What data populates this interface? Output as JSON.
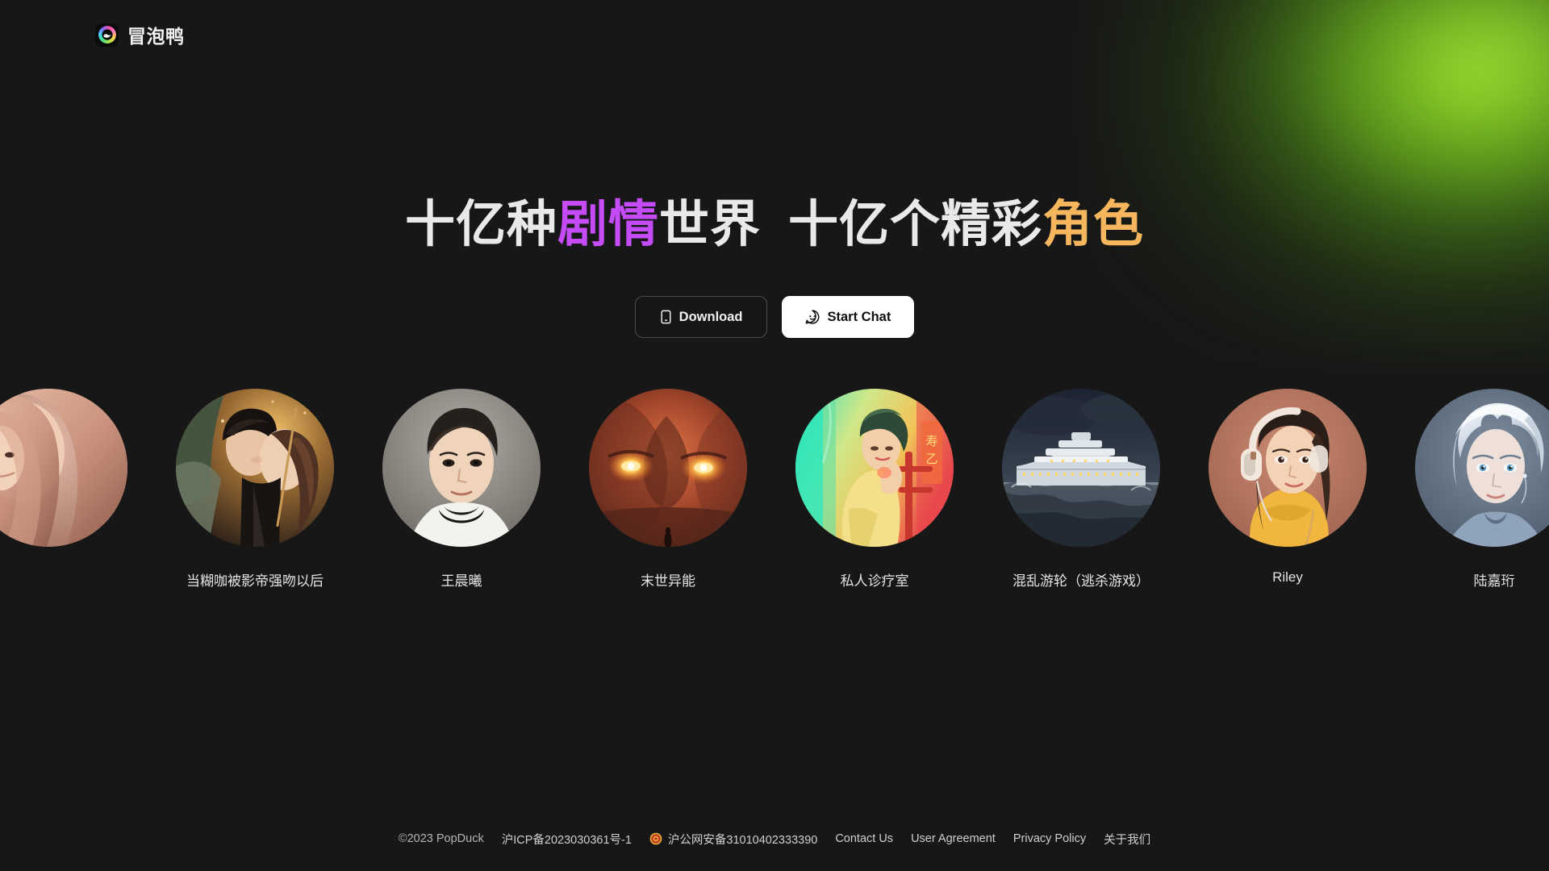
{
  "brand": {
    "name": "冒泡鸭",
    "logo_icon": "duck-ring-logo"
  },
  "hero": {
    "headline_parts": [
      {
        "text": "十亿种",
        "color": "#e9e9e9"
      },
      {
        "text": "剧情",
        "color": "#c44bf5"
      },
      {
        "text": "世界",
        "color": "#e9e9e9"
      },
      {
        "text": "十亿个精彩",
        "color": "#e9e9e9"
      },
      {
        "text": "角色",
        "color": "#f5b65e"
      }
    ],
    "headline_full": "十亿种剧情世界 十亿个精彩角色",
    "buttons": {
      "download_label": "Download",
      "download_icon": "mobile-phone-icon",
      "chat_label": "Start Chat",
      "chat_icon": "chat-bubble-icon"
    },
    "accent_glow_color": "#96e128"
  },
  "carousel": {
    "items": [
      {
        "name": "",
        "partial": true,
        "art": "woman-pink-hair"
      },
      {
        "name": "当糊咖被影帝强吻以后",
        "art": "couple-kiss-umbrella"
      },
      {
        "name": "王晨曦",
        "art": "young-man-portrait"
      },
      {
        "name": "末世异能",
        "art": "glowing-eyes-face"
      },
      {
        "name": "私人诊疗室",
        "art": "neon-room-woman"
      },
      {
        "name": "混乱游轮（逃杀游戏）",
        "art": "cruise-ship-storm"
      },
      {
        "name": "Riley",
        "art": "girl-headphones"
      },
      {
        "name": "陆嘉珩",
        "art": "silver-hair-boy"
      }
    ]
  },
  "footer": {
    "copyright": "©2023 PopDuck",
    "icp": "沪ICP备2023030361号-1",
    "police_badge_icon": "police-badge-icon",
    "police_beian": "沪公网安备31010402333390",
    "links": [
      "Contact Us",
      "User Agreement",
      "Privacy Policy",
      "关于我们"
    ]
  }
}
